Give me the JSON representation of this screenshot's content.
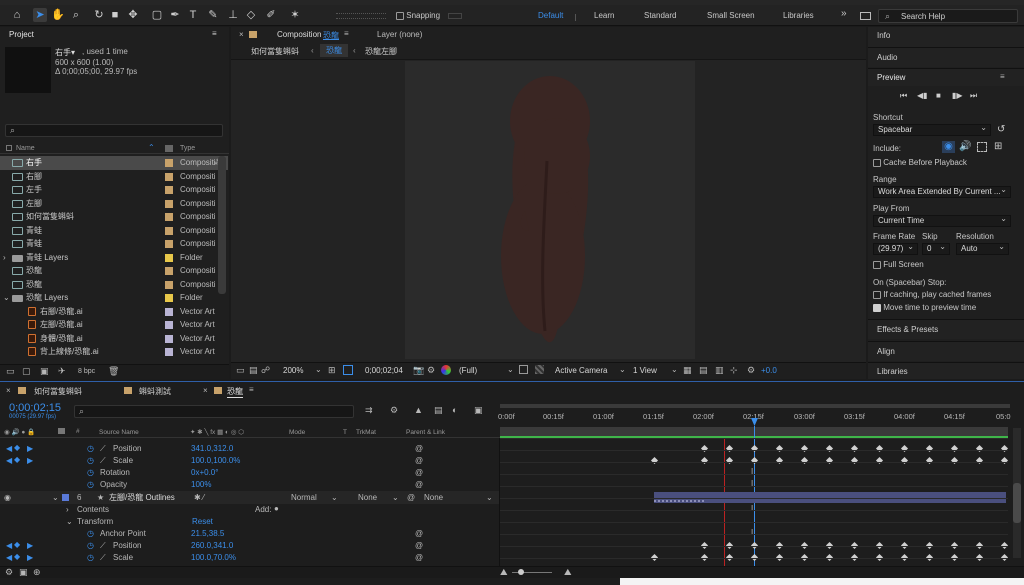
{
  "topbar": {
    "snapping_label": "Snapping",
    "workspaces": [
      "Default",
      "Learn",
      "Standard",
      "Small Screen",
      "Libraries"
    ],
    "search_placeholder": "Search Help",
    "overflow": "»"
  },
  "project": {
    "title": "Project",
    "selected_name": "右手▾",
    "selected_used": ", used 1 time",
    "selected_dims": "600 x 600 (1.00)",
    "selected_duration": "Δ 0;00;05;00, 29.97 fps",
    "col_name": "Name",
    "col_type": "Type",
    "bpc": "8 bpc",
    "items": [
      {
        "name": "右手",
        "type": "Compositi",
        "kind": "comp",
        "sel": true
      },
      {
        "name": "右腳",
        "type": "Compositi",
        "kind": "comp"
      },
      {
        "name": "左手",
        "type": "Compositi",
        "kind": "comp"
      },
      {
        "name": "左腳",
        "type": "Compositi",
        "kind": "comp"
      },
      {
        "name": "如何當隻蝌蚪",
        "type": "Compositi",
        "kind": "comp"
      },
      {
        "name": "青蛙",
        "type": "Compositi",
        "kind": "comp"
      },
      {
        "name": "青蛙",
        "type": "Compositi",
        "kind": "comp"
      },
      {
        "name": "青蛙 Layers",
        "type": "Folder",
        "kind": "folder"
      },
      {
        "name": "恐龍",
        "type": "Compositi",
        "kind": "comp"
      },
      {
        "name": "恐龍",
        "type": "Compositi",
        "kind": "comp"
      },
      {
        "name": "恐龍 Layers",
        "type": "Folder",
        "kind": "folder",
        "open": true
      },
      {
        "name": "右腳/恐龍.ai",
        "type": "Vector Art",
        "kind": "vector"
      },
      {
        "name": "左腳/恐龍.ai",
        "type": "Vector Art",
        "kind": "vector"
      },
      {
        "name": "身體/恐龍.ai",
        "type": "Vector Art",
        "kind": "vector"
      },
      {
        "name": "背上線條/恐龍.ai",
        "type": "Vector Art",
        "kind": "vector"
      }
    ]
  },
  "composition": {
    "tab_prefix": "Composition",
    "tab_name": "恐龍",
    "layer_tab": "Layer (none)",
    "breadcrumbs": [
      "如何當隻蝌蚪",
      "恐龍",
      "恐龍左腳"
    ],
    "zoom": "200%",
    "timecode": "0;00;02;04",
    "resolution": "(Full)",
    "camera": "Active Camera",
    "views": "1 View",
    "exposure": "+0.0"
  },
  "right": {
    "info": "Info",
    "audio": "Audio",
    "preview": "Preview",
    "shortcut_label": "Shortcut",
    "shortcut_value": "Spacebar",
    "include_label": "Include:",
    "cache_label": "Cache Before Playback",
    "range_label": "Range",
    "range_value": "Work Area Extended By Current ...",
    "playfrom_label": "Play From",
    "playfrom_value": "Current Time",
    "framerate_label": "Frame Rate",
    "skip_label": "Skip",
    "resolution_label": "Resolution",
    "framerate_value": "(29.97)",
    "skip_value": "0",
    "resolution_value": "Auto",
    "fullscreen_label": "Full Screen",
    "stop_label": "On (Spacebar) Stop:",
    "ifcaching_label": "If caching, play cached frames",
    "movetime_label": "Move time to preview time",
    "effects": "Effects & Presets",
    "align": "Align",
    "libraries": "Libraries"
  },
  "timeline": {
    "tabs": [
      "如何當隻蝌蚪",
      "蝌蚪測試",
      "恐龍"
    ],
    "timecode": "0;00;02;15",
    "frames": "00075 (29.97 fps)",
    "headers": {
      "source": "Source Name",
      "mode": "Mode",
      "t": "T",
      "trkmat": "TrkMat",
      "parent": "Parent & Link"
    },
    "ruler": [
      "0:00f",
      "00:15f",
      "01:00f",
      "01:15f",
      "02:00f",
      "02:15f",
      "03:00f",
      "03:15f",
      "04:00f",
      "04:15f",
      "05:0"
    ],
    "layer6": {
      "num": "6",
      "name": "左腳/恐龍 Outlines",
      "mode": "Normal",
      "trkmat": "None",
      "parent": "None"
    },
    "props": [
      {
        "label": "Anchor Point",
        "value": "",
        "key": "anchor_cut"
      },
      {
        "label": "Position",
        "value": "341.0,312.0"
      },
      {
        "label": "Scale",
        "value": "100.0,100.0%"
      },
      {
        "label": "Rotation",
        "value": "0x+0.0°"
      },
      {
        "label": "Opacity",
        "value": "100%"
      }
    ],
    "contents": "Contents",
    "add": "Add:",
    "transform": "Transform",
    "reset": "Reset",
    "props2": [
      {
        "label": "Anchor Point",
        "value": "21.5,38.5"
      },
      {
        "label": "Position",
        "value": "260.0,341.0"
      },
      {
        "label": "Scale",
        "value": "100.0,70.0%"
      }
    ]
  },
  "colors": {
    "accent": "#3b8eea",
    "panel": "#1f1f1f",
    "layerbar": "#4a4f7e",
    "playhead": "#3b8eea",
    "work_area": "#3fb54a",
    "dino": "#3a2623"
  }
}
